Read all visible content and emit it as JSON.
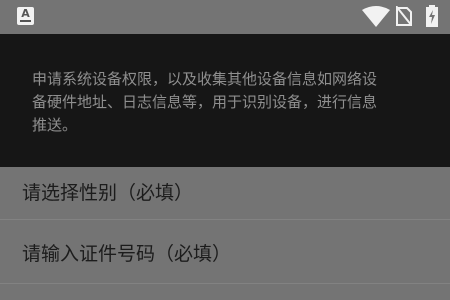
{
  "status_bar": {
    "app_icon_letter": "A",
    "icons": [
      "app-notification-icon",
      "wifi-icon",
      "no-sim-icon",
      "battery-charging-icon"
    ]
  },
  "notice": {
    "lines": [
      "申请系统设备权限，以及收集其他设备信息如网络设",
      "备硬件地址、日志信息等，用于识别设备，进行信息",
      "推送。"
    ]
  },
  "form": {
    "gender_placeholder": "请选择性别（必填）",
    "id_number_placeholder": "请输入证件号码（必填）"
  },
  "colors": {
    "background": "#747474",
    "notice_background": "#161616",
    "notice_text": "#8f8f8f",
    "field_text": "#1c1c1c"
  }
}
